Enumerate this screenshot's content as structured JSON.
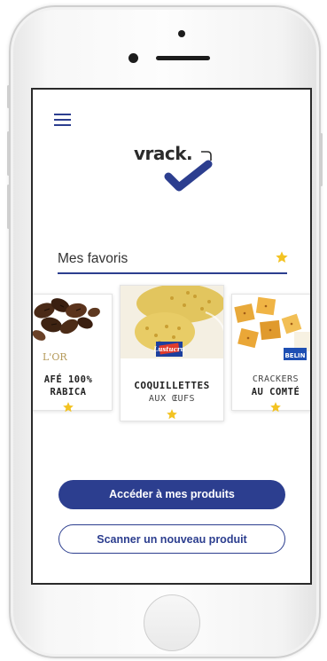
{
  "app": {
    "logo_text": "vrack.",
    "brand_color": "#2c3e8f",
    "star_color": "#f3c322"
  },
  "favorites": {
    "title": "Mes favoris"
  },
  "products": [
    {
      "line1": "AFÉ 100%",
      "line2": "RABICA",
      "brand_mark": "L'OR"
    },
    {
      "line1": "COQUILLETTES",
      "line2": "AUX ŒUFS",
      "brand_mark": "Lustucru"
    },
    {
      "line1": "CRACKERS",
      "line2": "AU COMTÉ",
      "brand_mark": "BELIN"
    }
  ],
  "actions": {
    "primary_label": "Accéder à mes produits",
    "secondary_label": "Scanner un nouveau produit"
  }
}
